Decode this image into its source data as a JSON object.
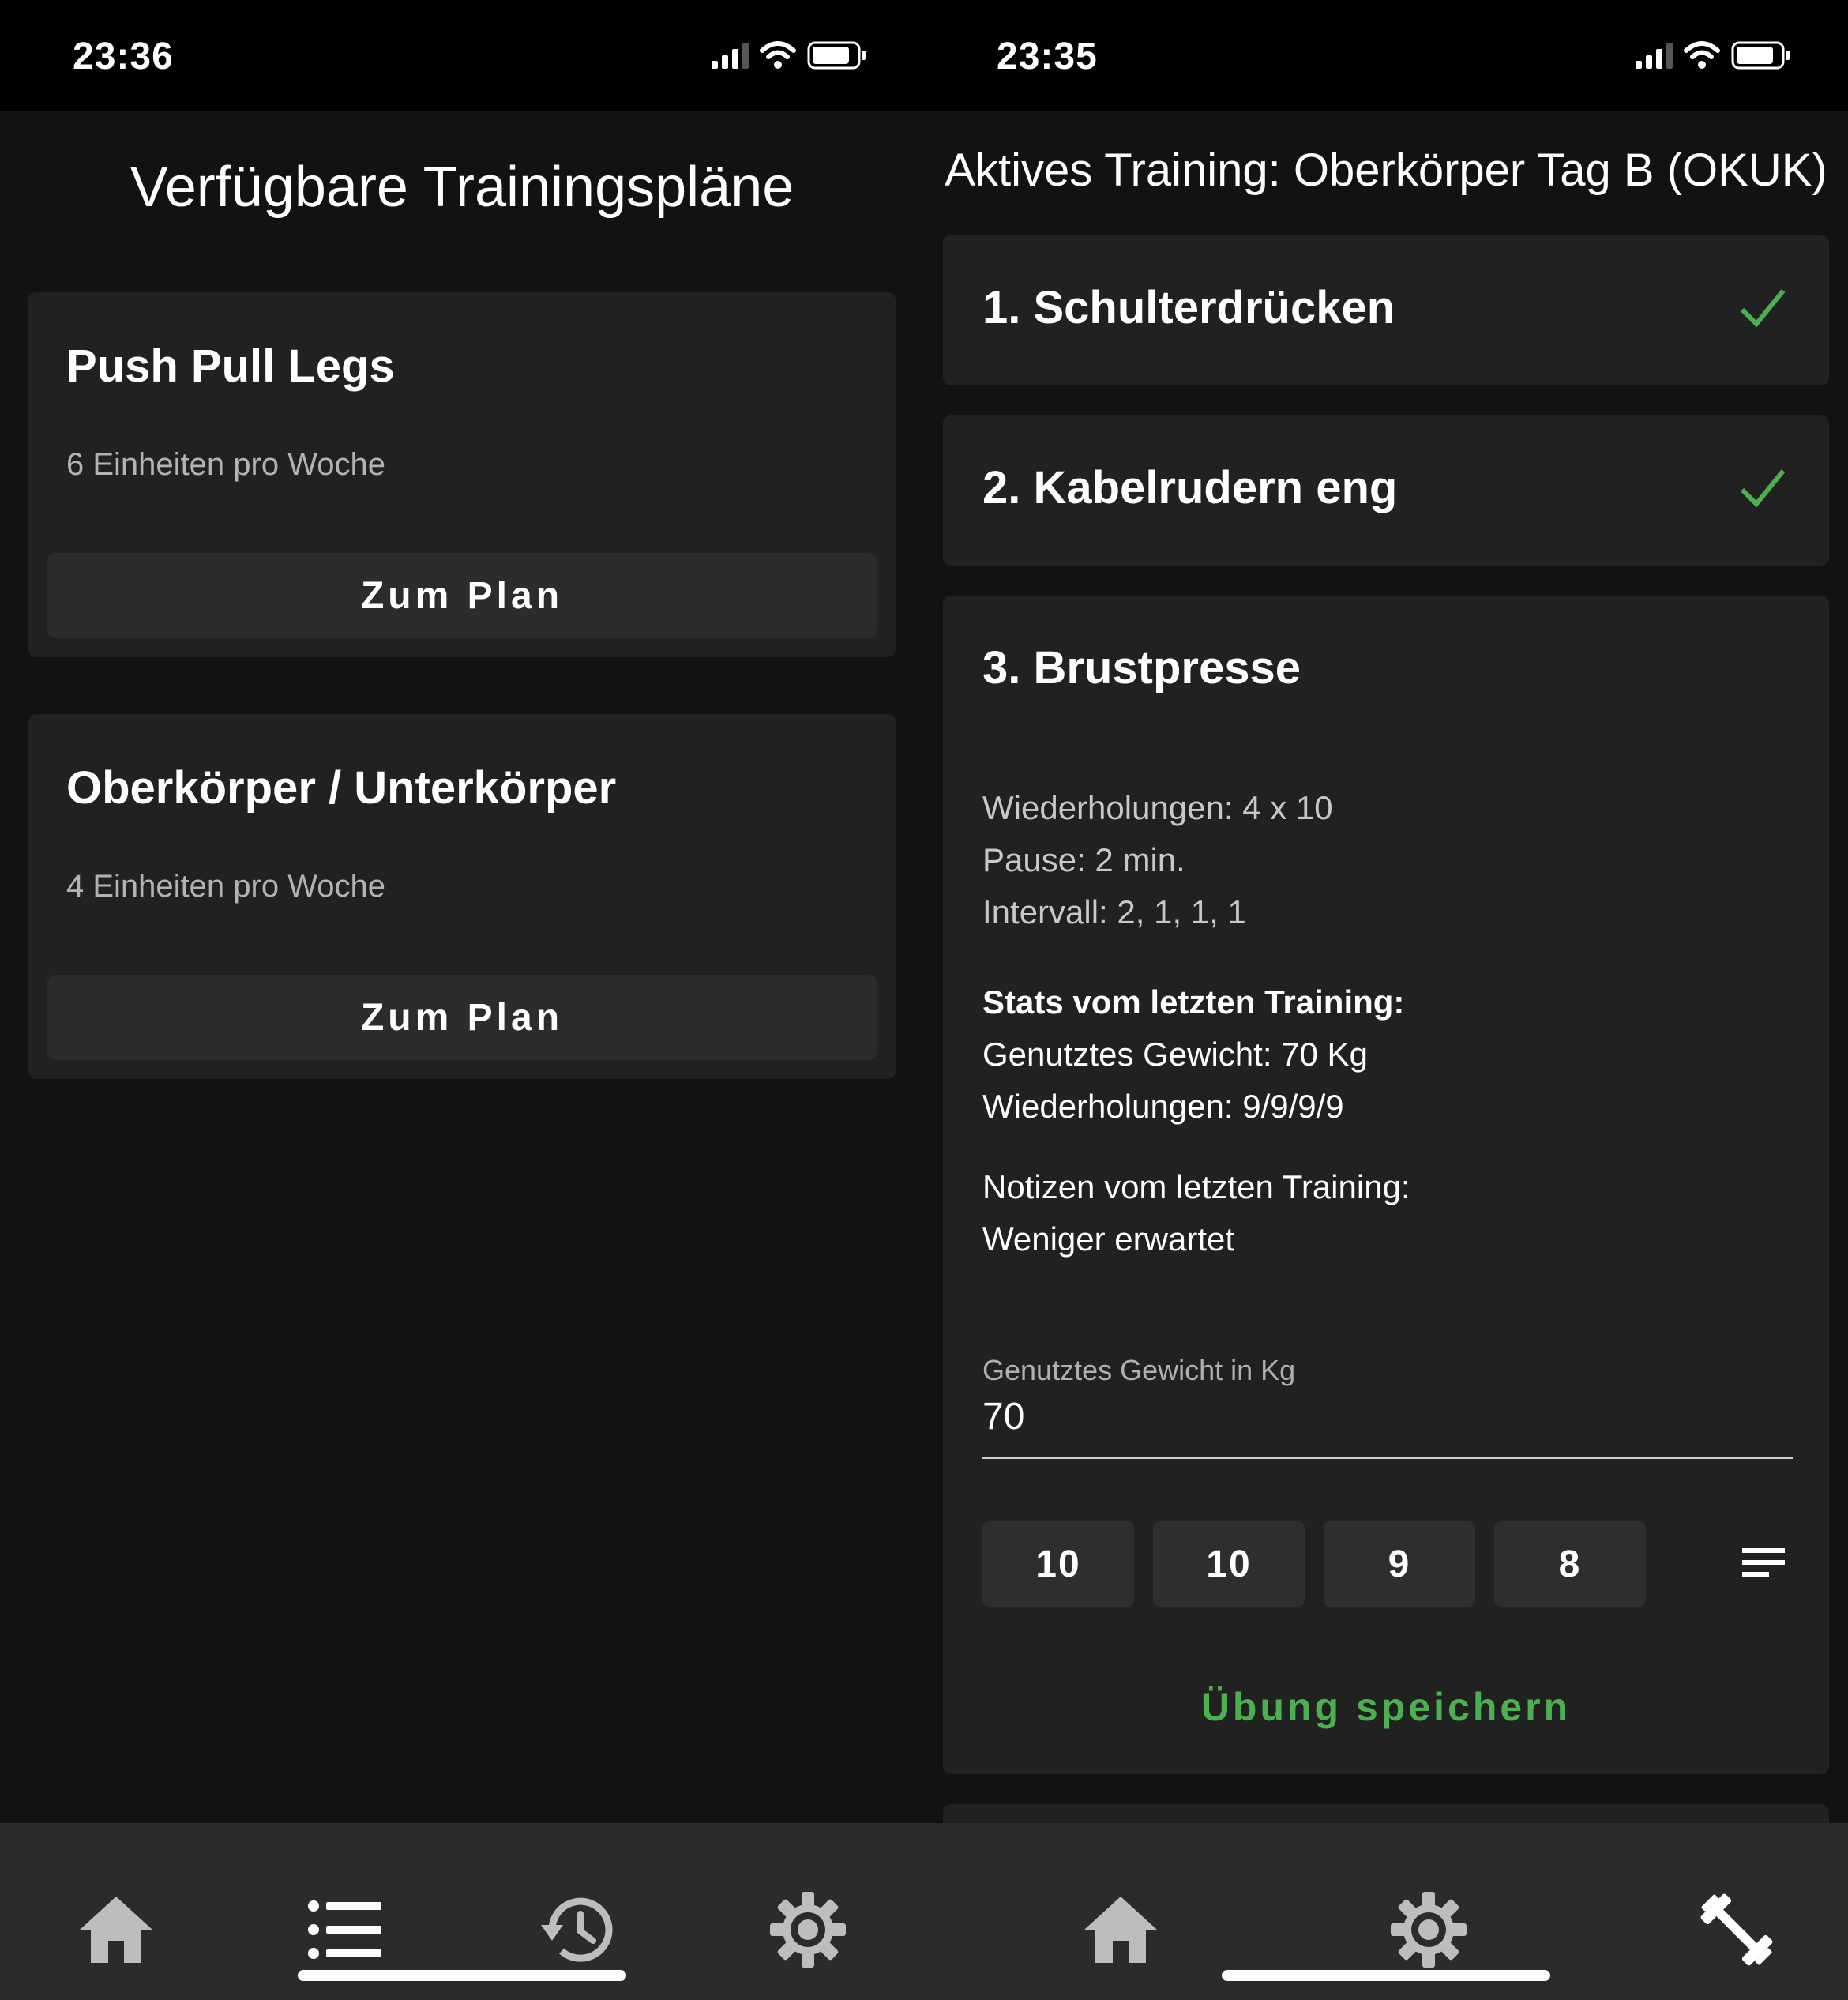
{
  "left": {
    "status": {
      "time": "23:36"
    },
    "page_title": "Verfügbare Trainingspläne",
    "plans": [
      {
        "name": "Push Pull Legs",
        "subtitle": "6 Einheiten pro Woche",
        "button": "Zum Plan"
      },
      {
        "name": "Oberkörper / Unterkörper",
        "subtitle": "4 Einheiten pro Woche",
        "button": "Zum Plan"
      }
    ],
    "nav": {
      "active": "plans-list",
      "icons": [
        "home-icon",
        "list-icon",
        "history-icon",
        "gear-icon"
      ]
    }
  },
  "right": {
    "status": {
      "time": "23:35"
    },
    "page_title": "Aktives Training: Oberkörper Tag B (OKUK)",
    "exercises": [
      {
        "title": "1. Schulterdrücken",
        "completed": true
      },
      {
        "title": "2. Kabelrudern eng",
        "completed": true
      },
      {
        "title": "3. Brustpresse",
        "reps_plan": "Wiederholungen: 4 x 10",
        "pause": "Pause: 2 min.",
        "interval": "Intervall: 2, 1, 1, 1",
        "stats_heading": "Stats vom letzten Training:",
        "stats_weight": "Genutztes Gewicht: 70 Kg",
        "stats_reps": "Wiederholungen: 9/9/9/9",
        "notes_heading": "Notizen vom letzten Training:",
        "notes": "Weniger erwartet",
        "weight_label": "Genutztes Gewicht in Kg",
        "weight_value": "70",
        "reps": [
          "10",
          "10",
          "9",
          "8"
        ],
        "save_label": "Übung speichern"
      }
    ],
    "nav": {
      "icons": [
        "home-icon",
        "gear-icon",
        "dumbbell-icon"
      ]
    }
  },
  "colors": {
    "accent": "#4caf50",
    "background": "#121212",
    "card": "#212121",
    "nav": "#2b2b2b"
  }
}
